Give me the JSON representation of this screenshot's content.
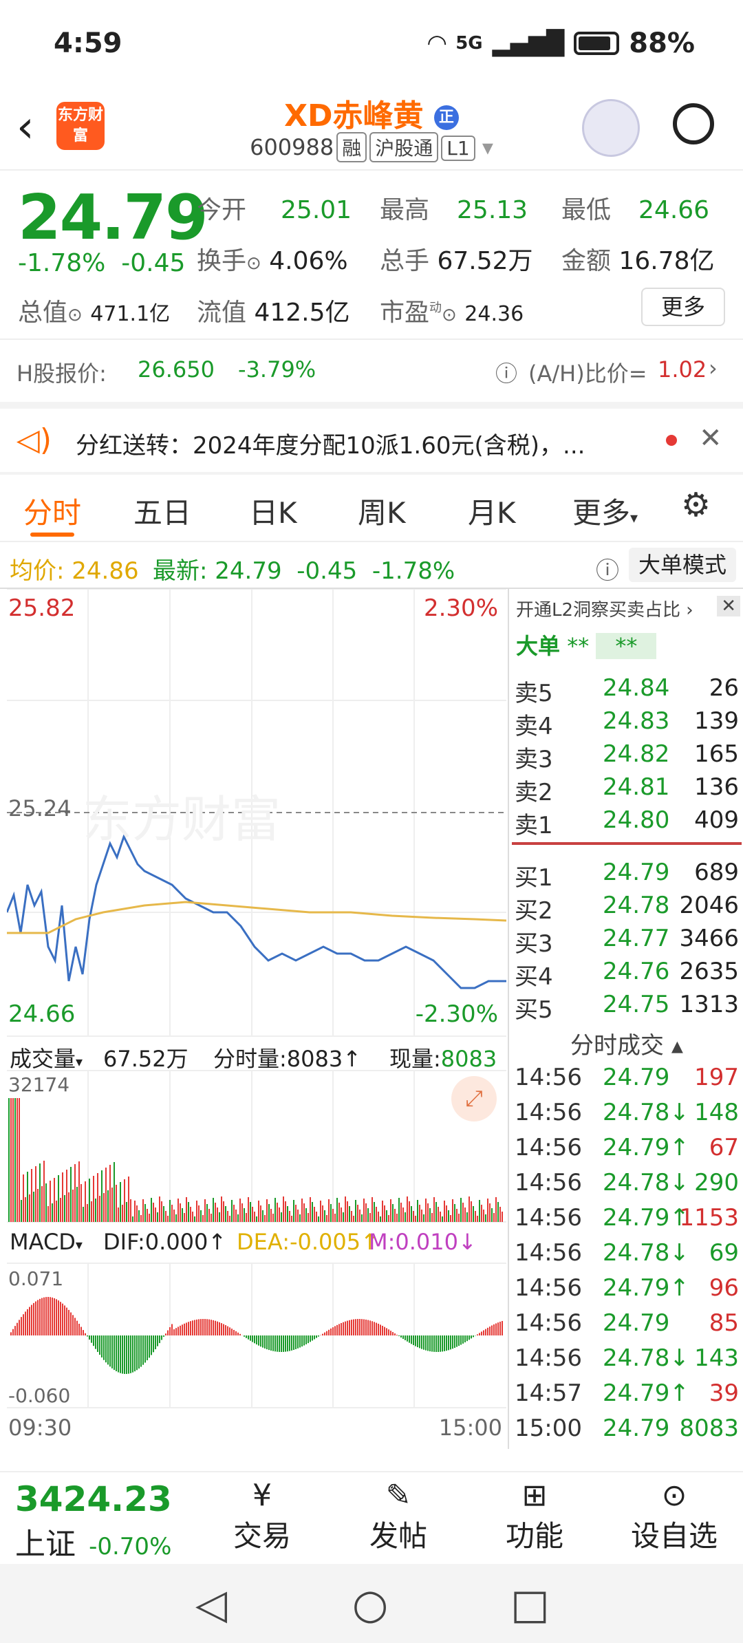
{
  "status": {
    "time": "4:59",
    "network": "5G",
    "battery": "88%"
  },
  "header": {
    "title": "XD赤峰黄",
    "code": "600988",
    "tags": [
      "融",
      "沪股通",
      "L1"
    ],
    "badge": "正",
    "logo_text": "东方财富"
  },
  "quote": {
    "price": "24.79",
    "pct": "-1.78%",
    "chg": "-0.45",
    "open_label": "今开",
    "open": "25.01",
    "high_label": "最高",
    "high": "25.13",
    "low_label": "最低",
    "low": "24.66",
    "turnover_label": "换手",
    "turnover": "4.06%",
    "volume_label": "总手",
    "volume": "67.52万",
    "amount_label": "金额",
    "amount": "16.78亿",
    "mcap_label": "总值",
    "mcap": "471.1亿",
    "float_label": "流值",
    "float": "412.5亿",
    "pe_label": "市盈",
    "pe_sup": "动",
    "pe": "24.36",
    "more": "更多"
  },
  "hshare": {
    "label": "H股报价:",
    "price": "26.650",
    "pct": "-3.79%",
    "ah_label": "(A/H)比价=",
    "ah": "1.02"
  },
  "notice": {
    "text": "分红送转：2024年度分配10派1.60元(含税)，..."
  },
  "tabs": [
    "分时",
    "五日",
    "日K",
    "周K",
    "月K",
    "更多"
  ],
  "avgbar": {
    "avg_label": "均价:",
    "avg": "24.86",
    "last_label": "最新:",
    "last": "24.79",
    "chg": "-0.45",
    "pct": "-1.78%",
    "mode": "大单模式"
  },
  "chart": {
    "high": "25.82",
    "high_pct": "2.30%",
    "low": "24.66",
    "low_pct": "-2.30%",
    "prev_close": "25.24",
    "watermark": "东方财富",
    "vol_label": "成交量",
    "vol_total": "67.52万",
    "vol_tick_label": "分时量:",
    "vol_tick": "8083",
    "vol_now_label": "现量:",
    "vol_now": "8083",
    "vol_max": "32174",
    "macd_label": "MACD",
    "dif": "DIF:0.000",
    "dea": "DEA:-0.005",
    "m": "M:0.010",
    "macd_max": "0.071",
    "macd_min": "-0.060",
    "t_start": "09:30",
    "t_end": "15:00",
    "colors": {
      "price": "#3a6fc2",
      "avg": "#e6b84a",
      "up": "#e53935",
      "down": "#1a9a2a"
    }
  },
  "side": {
    "l2": "开通L2洞察买卖占比",
    "big_label": "大单",
    "big_v1": "**",
    "big_v2": "**",
    "asks": [
      [
        "卖5",
        "24.84",
        "26"
      ],
      [
        "卖4",
        "24.83",
        "139"
      ],
      [
        "卖3",
        "24.82",
        "165"
      ],
      [
        "卖2",
        "24.81",
        "136"
      ],
      [
        "卖1",
        "24.80",
        "409"
      ]
    ],
    "bids": [
      [
        "买1",
        "24.79",
        "689"
      ],
      [
        "买2",
        "24.78",
        "2046"
      ],
      [
        "买3",
        "24.77",
        "3466"
      ],
      [
        "买4",
        "24.76",
        "2635"
      ],
      [
        "买5",
        "24.75",
        "1313"
      ]
    ],
    "trades_label": "分时成交",
    "trades": [
      [
        "14:56",
        "24.79",
        "",
        "197",
        "red"
      ],
      [
        "14:56",
        "24.78",
        "↓",
        "148",
        "green"
      ],
      [
        "14:56",
        "24.79",
        "↑",
        "67",
        "red"
      ],
      [
        "14:56",
        "24.78",
        "↓",
        "290",
        "green"
      ],
      [
        "14:56",
        "24.79",
        "↑",
        "1153",
        "red"
      ],
      [
        "14:56",
        "24.78",
        "↓",
        "69",
        "green"
      ],
      [
        "14:56",
        "24.79",
        "↑",
        "96",
        "red"
      ],
      [
        "14:56",
        "24.79",
        "",
        "85",
        "red"
      ],
      [
        "14:56",
        "24.78",
        "↓",
        "143",
        "green"
      ],
      [
        "14:57",
        "24.79",
        "↑",
        "39",
        "red"
      ],
      [
        "15:00",
        "24.79",
        "",
        "8083",
        "green"
      ]
    ]
  },
  "bottom": {
    "index": "3424.23",
    "index_name": "上证",
    "index_pct": "-0.70%",
    "items": [
      "交易",
      "发帖",
      "功能",
      "设自选"
    ]
  }
}
